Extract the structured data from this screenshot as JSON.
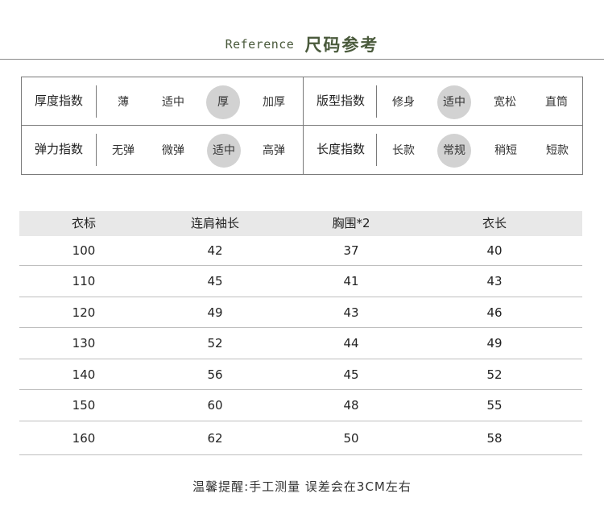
{
  "header": {
    "en": "Reference",
    "zh": "尺码参考"
  },
  "indices": [
    {
      "title": "厚度指数",
      "options": [
        "薄",
        "适中",
        "厚",
        "加厚"
      ],
      "selected": 2
    },
    {
      "title": "版型指数",
      "options": [
        "修身",
        "适中",
        "宽松",
        "直筒"
      ],
      "selected": 1
    },
    {
      "title": "弹力指数",
      "options": [
        "无弹",
        "微弹",
        "适中",
        "高弹"
      ],
      "selected": 2
    },
    {
      "title": "长度指数",
      "options": [
        "长款",
        "常规",
        "稍短",
        "短款"
      ],
      "selected": 1
    }
  ],
  "size_table": {
    "headers": [
      "衣标",
      "连肩袖长",
      "胸围*2",
      "衣长"
    ],
    "rows": [
      [
        "100",
        "42",
        "37",
        "40"
      ],
      [
        "110",
        "45",
        "41",
        "43"
      ],
      [
        "120",
        "49",
        "43",
        "46"
      ],
      [
        "130",
        "52",
        "44",
        "49"
      ],
      [
        "140",
        "56",
        "45",
        "52"
      ],
      [
        "150",
        "60",
        "48",
        "55"
      ],
      [
        "160",
        "62",
        "50",
        "58"
      ]
    ]
  },
  "footer": "温馨提醒:手工测量 误差会在3CM左右",
  "colors": {
    "accent": "#4a5a3c",
    "selected": "#d2d2d2",
    "header_band": "#e8e8e8"
  }
}
